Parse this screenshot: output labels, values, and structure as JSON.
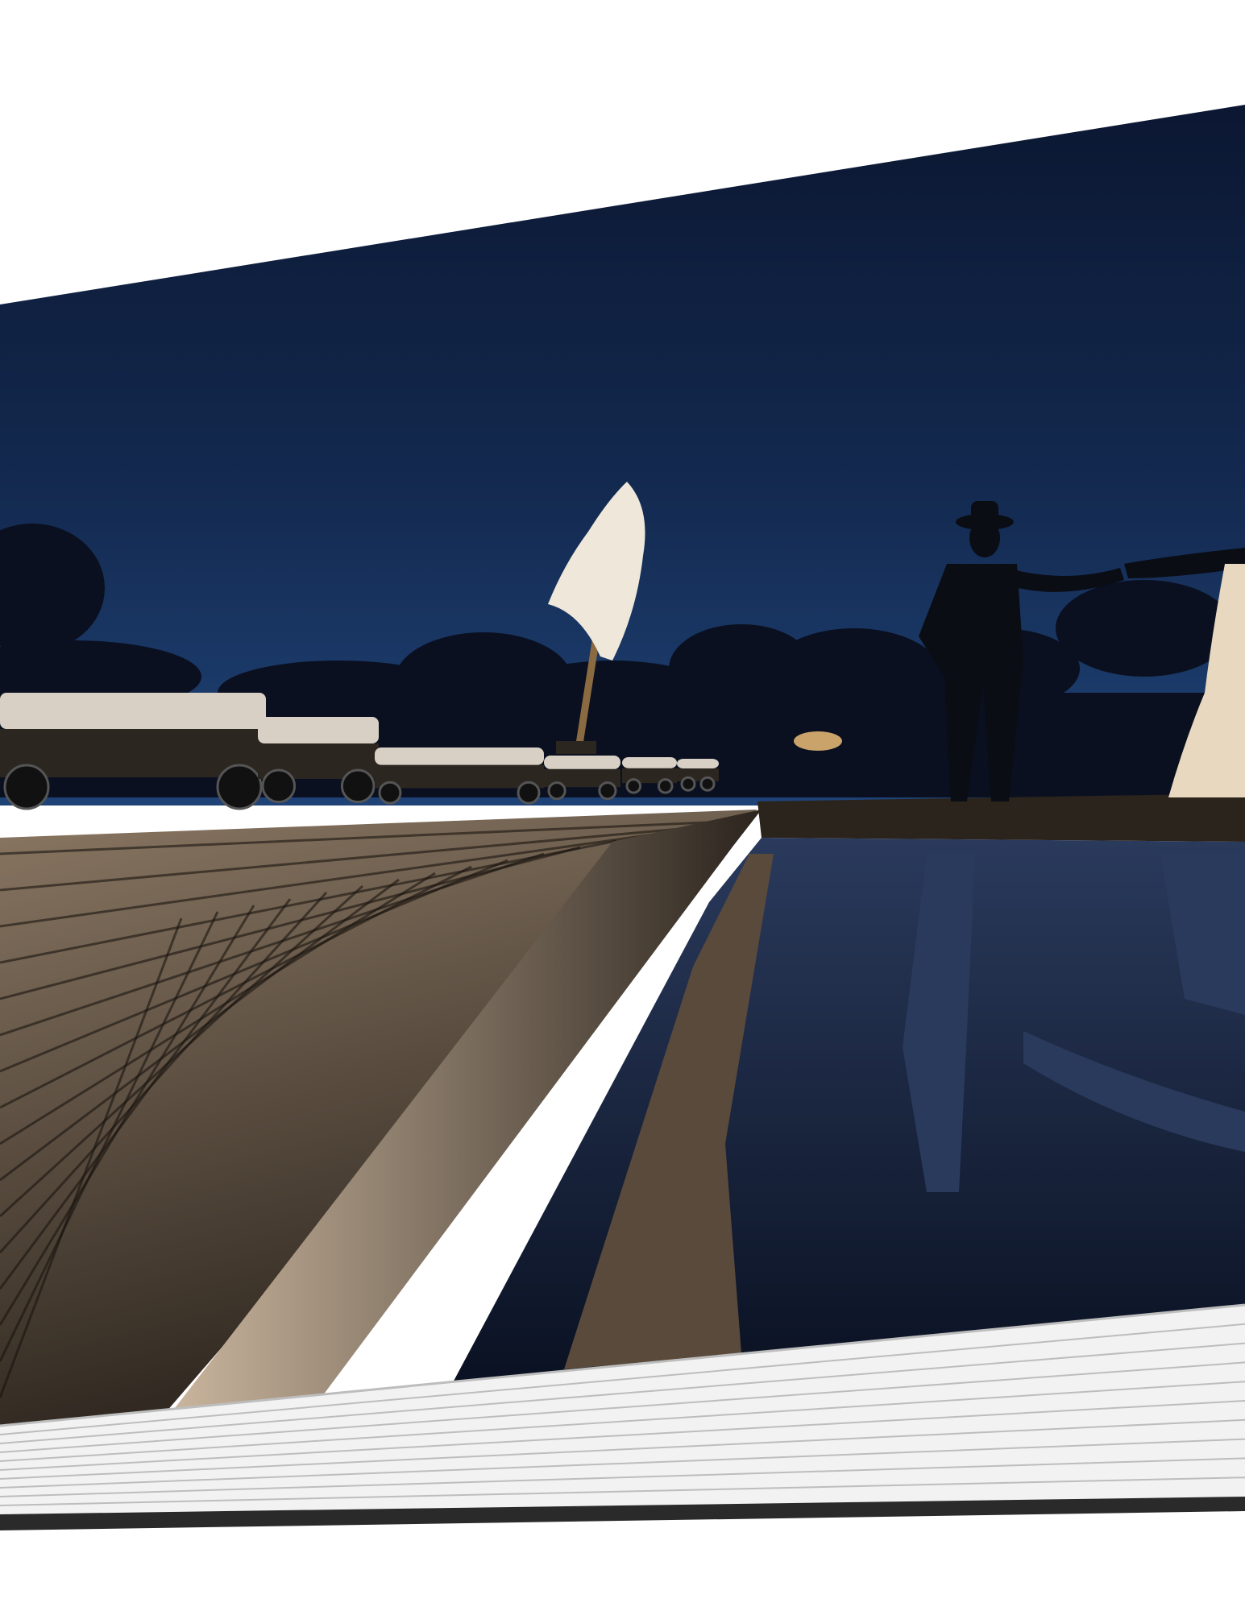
{
  "scene": {
    "subject": "photo-album-spread",
    "colors": {
      "background": "#ffffff",
      "sky_top": "#0b1630",
      "sky_mid": "#13294f",
      "sky_horizon": "#1f4377",
      "cloud": "#0a1020",
      "deck_light": "#8a7763",
      "deck_dark": "#2b241d",
      "deck_line": "#1a1510",
      "edge_light": "#cdb8a0",
      "pool_water": "#0a1122",
      "pool_reflection": "#2a3a5c",
      "pebbles": "#5a4a3c",
      "cushion": "#d8d0c4",
      "chair_frame": "#2c2620",
      "umbrella": "#efe7da",
      "silhouette": "#0a0d14",
      "dress": "#e8d8c0",
      "pages": "#f2f2f2",
      "page_line": "#bdbdbd",
      "cover": "#2a2a2a"
    }
  }
}
